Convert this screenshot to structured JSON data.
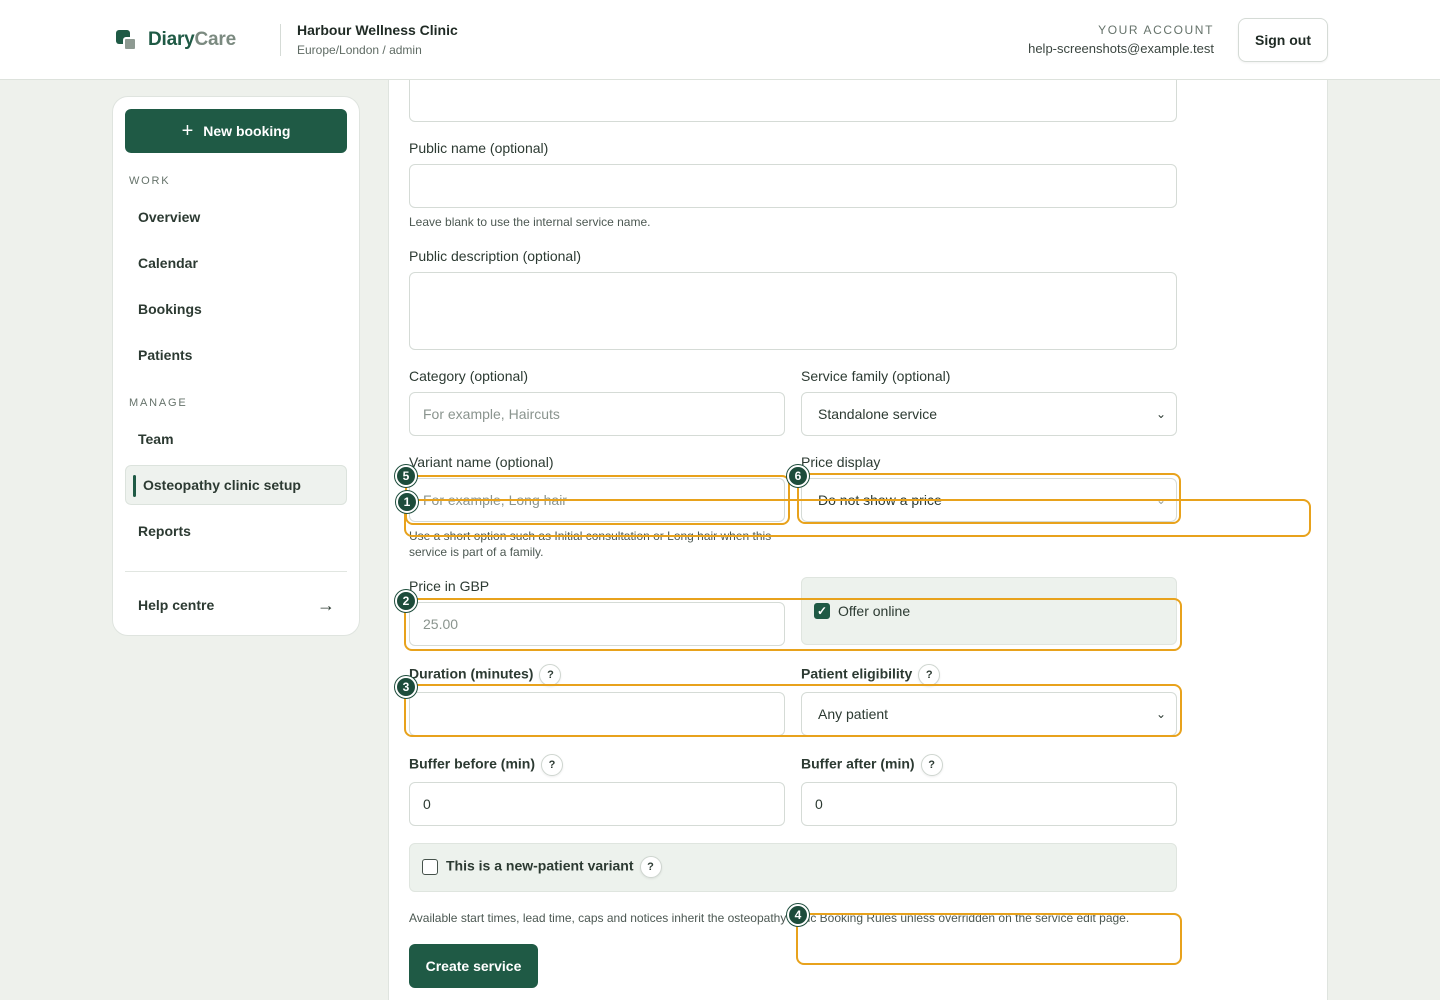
{
  "header": {
    "logo_primary": "Diary",
    "logo_secondary": "Care",
    "clinic_name": "Harbour Wellness Clinic",
    "clinic_sub": "Europe/London / admin",
    "account_label": "YOUR ACCOUNT",
    "account_email": "help-screenshots@example.test",
    "sign_out": "Sign out"
  },
  "sidebar": {
    "new_booking": "New booking",
    "sections": {
      "work": "WORK",
      "manage": "MANAGE"
    },
    "work_items": [
      "Overview",
      "Calendar",
      "Bookings",
      "Patients"
    ],
    "manage_items": [
      "Team",
      "Osteopathy clinic setup",
      "Reports"
    ],
    "active_item": "Osteopathy clinic setup",
    "help_centre": "Help centre",
    "help_arrow": "→"
  },
  "form": {
    "public_name_label": "Public name (optional)",
    "public_name_value": "",
    "public_name_hint": "Leave blank to use the internal service name.",
    "public_description_label": "Public description (optional)",
    "category_label": "Category (optional)",
    "category_placeholder": "For example, Haircuts",
    "service_family_label": "Service family (optional)",
    "service_family_value": "Standalone service",
    "variant_name_label": "Variant name (optional)",
    "variant_name_placeholder": "For example, Long hair",
    "variant_hint": "Use a short option such as Initial consultation or Long hair when this service is part of a family.",
    "price_display_label": "Price display",
    "price_display_value": "Do not show a price",
    "price_label": "Price in GBP",
    "price_placeholder": "25.00",
    "offer_online_label": "Offer online",
    "offer_online_checked": true,
    "duration_label": "Duration (minutes)",
    "duration_value": "",
    "eligibility_label": "Patient eligibility",
    "eligibility_value": "Any patient",
    "buffer_before_label": "Buffer before (min)",
    "buffer_before_value": "0",
    "buffer_after_label": "Buffer after (min)",
    "buffer_after_value": "0",
    "new_patient_label": "This is a new-patient variant",
    "new_patient_checked": false,
    "footer_note": "Available start times, lead time, caps and notices inherit the osteopathy clinic Booking Rules unless overridden on the service edit page.",
    "create_button": "Create service",
    "help_glyph": "?"
  },
  "annotations": [
    "1",
    "2",
    "3",
    "4",
    "5",
    "6"
  ],
  "colors": {
    "brand": "#1f5a45",
    "highlight": "#e8a21c",
    "marker": "#1d4c3b"
  }
}
